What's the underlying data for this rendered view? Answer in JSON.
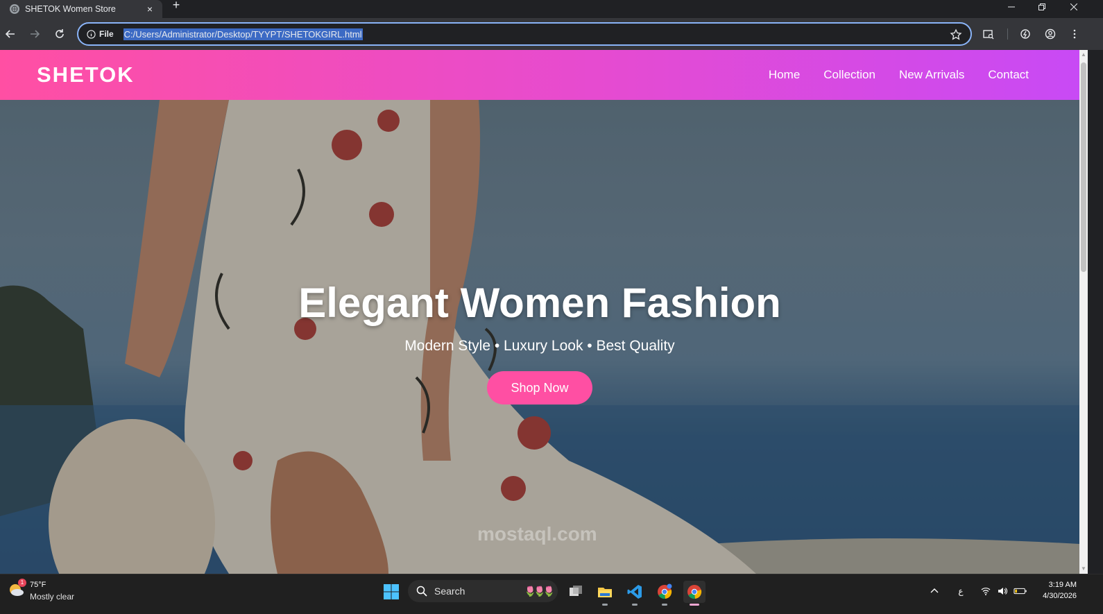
{
  "browser": {
    "tab_title": "SHETOK Women Store",
    "new_tab_label": "+",
    "close_label": "×",
    "scheme": "File",
    "url": "C:/Users/Administrator/Desktop/TYYPT/SHETOKGIRL.html"
  },
  "site": {
    "logo": "SHETOK",
    "nav": [
      "Home",
      "Collection",
      "New Arrivals",
      "Contact"
    ],
    "hero": {
      "title": "Elegant Women Fashion",
      "subtitle": "Modern Style • Luxury Look • Best Quality",
      "cta": "Shop Now"
    },
    "watermark": "mostaql.com"
  },
  "taskbar": {
    "weather_temp": "75°F",
    "weather_desc": "Mostly clear",
    "weather_badge": "1",
    "search_label": "Search",
    "keyboard_lang": "ع",
    "time": "3:19 AM",
    "date": "4/30/2026"
  },
  "colors": {
    "header_start": "#ff4fa3",
    "header_end": "#c84af5",
    "cta": "#ff4fa3",
    "omnibox_focus": "#8ab4f8"
  }
}
